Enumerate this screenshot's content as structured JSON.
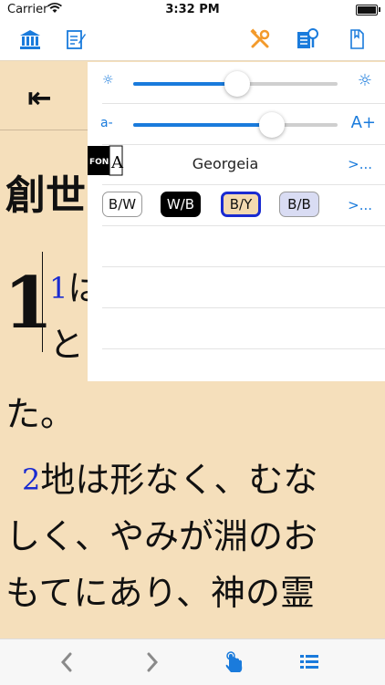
{
  "status_bar": {
    "carrier": "Carrier",
    "time": "3:32 PM"
  },
  "toolbar": {
    "icons": [
      "library-icon",
      "notes-icon",
      "tools-icon",
      "search-icon",
      "bookmark-icon"
    ],
    "accent": "#1a7bdc",
    "tools_color": "#f39a2b"
  },
  "reader": {
    "back_symbol": "⇤",
    "chapter_title": "創世",
    "chapter_number": "1",
    "verse1_num": "1",
    "verse1_line1": "は",
    "verse1_line2": "と",
    "verse1_tail": "た。",
    "verse2_num": "2",
    "verse2_line1": "地は形なく、むな",
    "verse2_line2": "しく、やみが淵のお",
    "verse2_line3": "もてにあり、神の霊",
    "background": "#f5dfbb"
  },
  "settings": {
    "brightness": {
      "min_icon": "☼",
      "max_icon": "☼",
      "value": 0.5
    },
    "font_size": {
      "min_label": "a-",
      "max_label": "A+",
      "value": 0.67
    },
    "font": {
      "icon_text": "FON",
      "icon_letter": "A",
      "name": "Georgeia",
      "more": ">..."
    },
    "themes": [
      {
        "label": "B/W",
        "bg": "#ffffff",
        "fg": "#111111",
        "border": "#999999"
      },
      {
        "label": "W/B",
        "bg": "#000000",
        "fg": "#ffffff",
        "border": "#000000"
      },
      {
        "label": "B/Y",
        "bg": "#f3d9b0",
        "fg": "#111111",
        "border": "#1a2bd1"
      },
      {
        "label": "B/B",
        "bg": "#d9dcf3",
        "fg": "#111111",
        "border": "#999999"
      }
    ],
    "themes_more": ">..."
  },
  "bottom_bar": {
    "icons": [
      "prev-chevron-icon",
      "next-chevron-icon",
      "touch-icon",
      "list-icon"
    ]
  }
}
